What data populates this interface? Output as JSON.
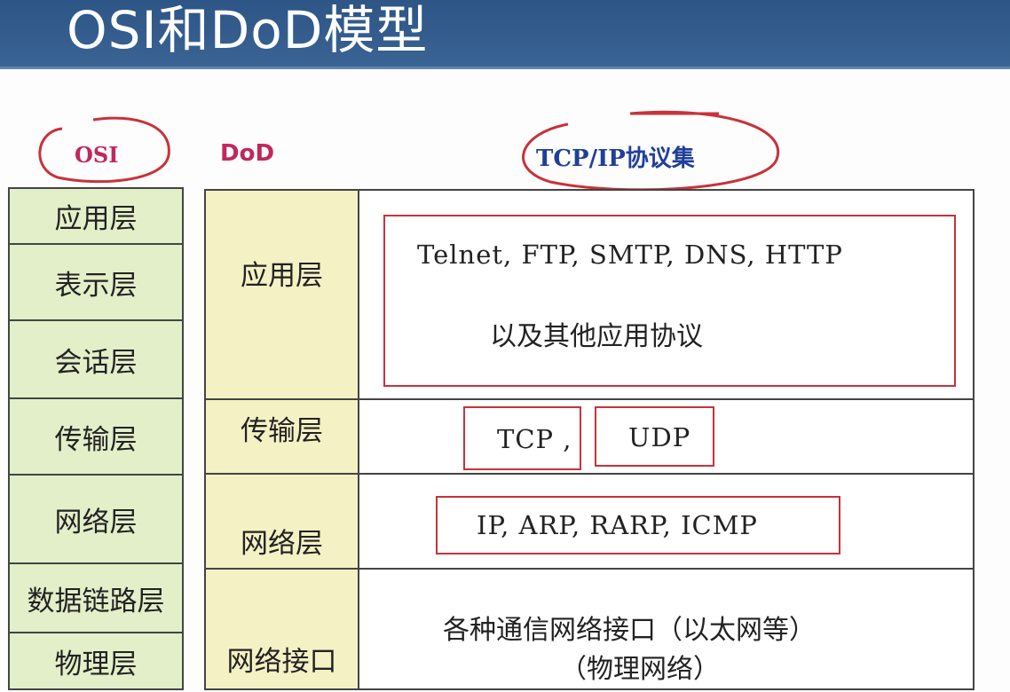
{
  "title": "OSI和DoD模型",
  "headers": {
    "osi": "OSI",
    "dod": "DoD",
    "tcpip": "TCP/IP协议集"
  },
  "osi_layers": [
    "应用层",
    "表示层",
    "会话层",
    "传输层",
    "网络层",
    "数据链路层",
    "物理层"
  ],
  "dod_layers": [
    "应用层",
    "传输层",
    "网络层",
    "网络接口"
  ],
  "tcpip": {
    "application_protocols": "Telnet, FTP, SMTP, DNS, HTTP",
    "application_other": "以及其他应用协议",
    "transport_tcp": "TCP ,",
    "transport_udp": "UDP",
    "network": "IP, ARP, RARP, ICMP",
    "interface_line1": "各种通信网络接口（以太网等）",
    "interface_line2": "（物理网络）"
  },
  "colors": {
    "title_bg": "#2d5585",
    "osi_fill": "#e2efc9",
    "dod_fill": "#f4f1c4",
    "annotation_red": "#c8323a",
    "osi_header": "#c0285a",
    "dod_header": "#c0285a",
    "tcpip_header": "#1f3f9a"
  }
}
